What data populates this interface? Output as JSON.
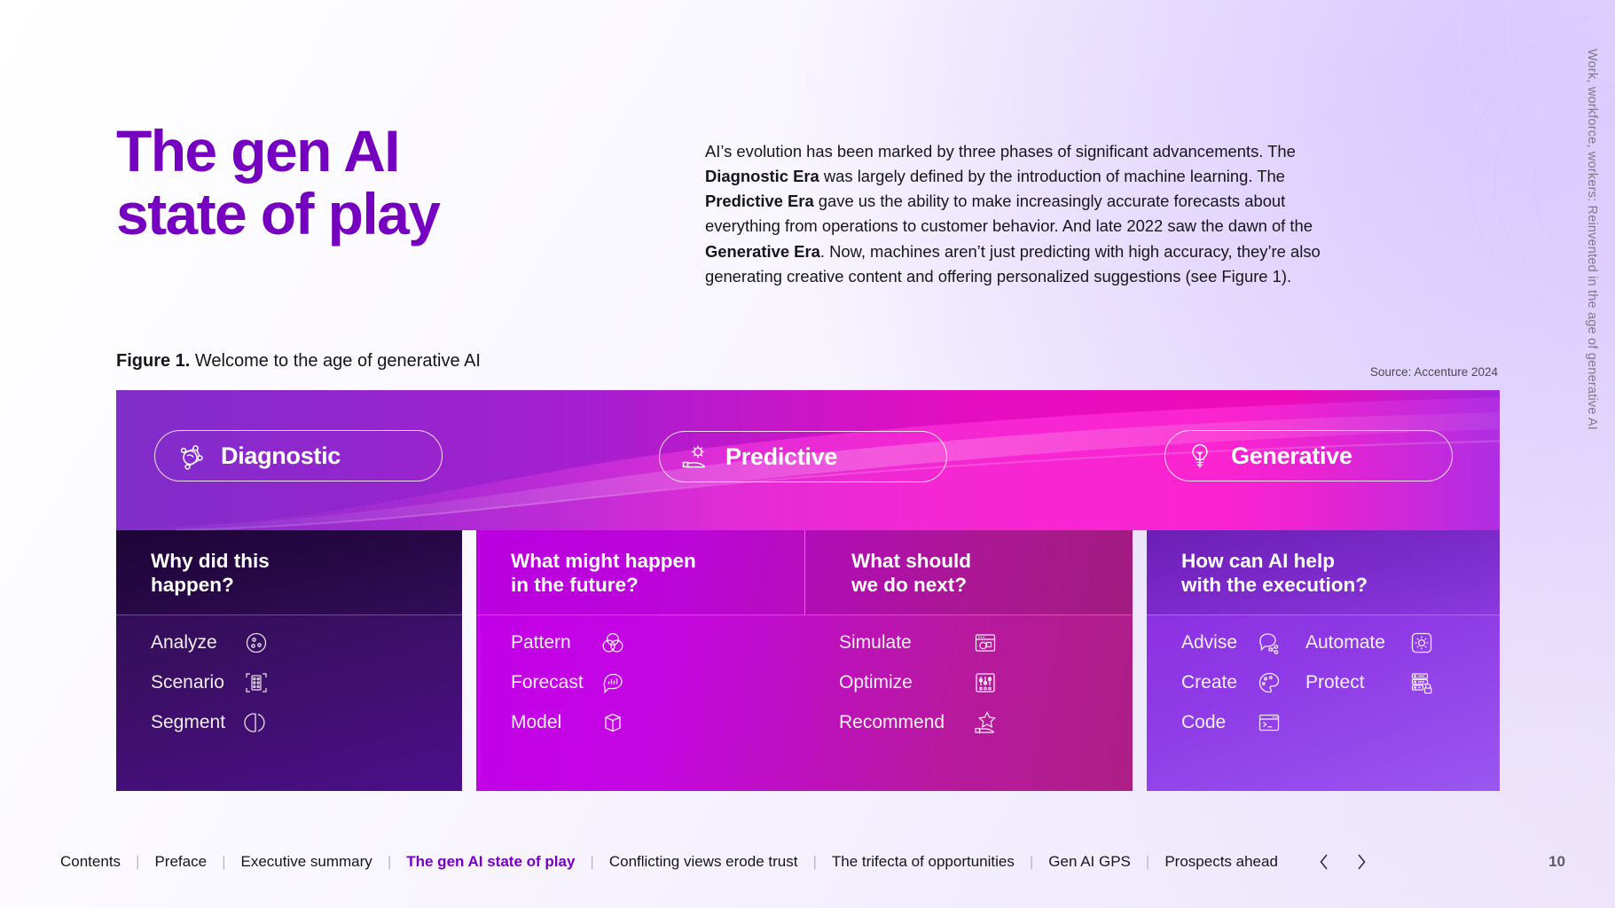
{
  "page": {
    "title_line1": "The gen AI",
    "title_line2": "state of play",
    "vertical_running_head": "Work, workforce, workers: Reinvented in the age of generative AI",
    "page_number": "10",
    "accent_color": "#7500c0"
  },
  "intro": {
    "p1": "AI’s evolution has been marked by three phases of significant advancements. The ",
    "b1": "Diagnostic Era",
    "p2": " was largely defined by the introduction of machine learning. The ",
    "b2": "Predictive Era",
    "p3": " gave us the ability to make increasingly accurate forecasts about everything from operations to customer behavior. And late 2022 saw the dawn of the ",
    "b3": "Generative Era",
    "p4": ". Now, machines aren’t just predicting with high accuracy, they’re also generating creative content and offering personalized suggestions (see Figure 1)."
  },
  "figure": {
    "label": "Figure 1.",
    "caption": " Welcome to the age of generative AI",
    "source": "Source: Accenture 2024",
    "eras": [
      {
        "name": "Diagnostic",
        "icon": "network-atom-icon"
      },
      {
        "name": "Predictive",
        "icon": "hand-gear-icon"
      },
      {
        "name": "Generative",
        "icon": "lightbulb-icon"
      }
    ],
    "columns": [
      {
        "id": "diagnostic",
        "question": "Why did this\nhappen?",
        "question_l1": "Why did this",
        "question_l2": "happen?",
        "capabilities": [
          {
            "label": "Analyze",
            "icon": "dots-circle-icon"
          },
          {
            "label": "Scenario",
            "icon": "scan-nodes-icon"
          },
          {
            "label": "Segment",
            "icon": "pie-segment-icon"
          }
        ]
      },
      {
        "id": "predictive-future",
        "question_l1": "What might happen",
        "question_l2": "in the future?",
        "capabilities": [
          {
            "label": "Pattern",
            "icon": "venn-diagram-icon"
          },
          {
            "label": "Forecast",
            "icon": "chart-bubble-icon"
          },
          {
            "label": "Model",
            "icon": "cube-icon"
          }
        ]
      },
      {
        "id": "predictive-next",
        "question_l1": "What should",
        "question_l2": "we do next?",
        "capabilities": [
          {
            "label": "Simulate",
            "icon": "browser-shapes-icon"
          },
          {
            "label": "Optimize",
            "icon": "sliders-icon"
          },
          {
            "label": "Recommend",
            "icon": "star-hand-icon"
          }
        ]
      },
      {
        "id": "generative",
        "question_l1": "How can AI help",
        "question_l2": "with the execution?",
        "capabilities_left": [
          {
            "label": "Advise",
            "icon": "chat-share-icon"
          },
          {
            "label": "Create",
            "icon": "palette-icon"
          },
          {
            "label": "Code",
            "icon": "terminal-icon"
          }
        ],
        "capabilities_right": [
          {
            "label": "Automate",
            "icon": "gear-square-icon"
          },
          {
            "label": "Protect",
            "icon": "server-lock-icon"
          }
        ]
      }
    ]
  },
  "bottom_nav": {
    "items": [
      {
        "label": "Contents",
        "active": false
      },
      {
        "label": "Preface",
        "active": false
      },
      {
        "label": "Executive summary",
        "active": false
      },
      {
        "label": "The gen AI state of play",
        "active": true
      },
      {
        "label": "Conflicting views erode trust",
        "active": false
      },
      {
        "label": "The trifecta of opportunities",
        "active": false
      },
      {
        "label": "Gen AI GPS",
        "active": false
      },
      {
        "label": "Prospects ahead",
        "active": false
      }
    ],
    "prev_icon": "chevron-left-icon",
    "next_icon": "chevron-right-icon",
    "separator": "|"
  }
}
